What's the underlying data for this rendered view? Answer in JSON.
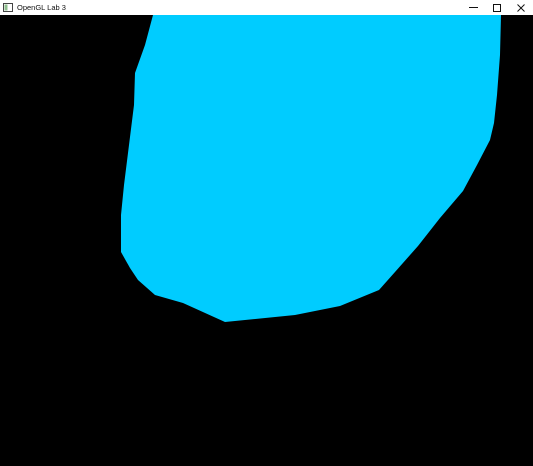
{
  "window": {
    "title": "OpenGL Lab 3",
    "icon": "window-app-icon",
    "controls": {
      "minimize_icon": "minimize-icon",
      "maximize_icon": "maximize-icon",
      "close_icon": "close-icon"
    }
  },
  "canvas": {
    "background_color": "#000000",
    "shape_color": "#00CCFF"
  }
}
